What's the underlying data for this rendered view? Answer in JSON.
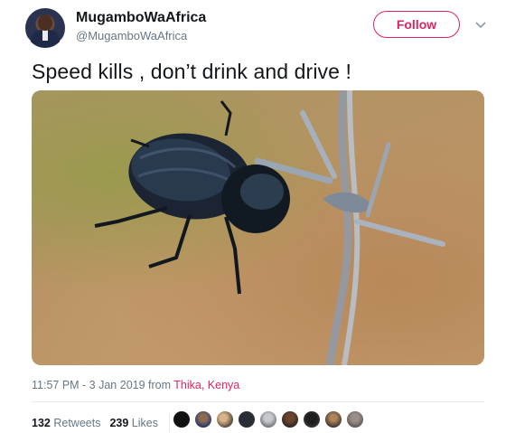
{
  "user": {
    "display_name": "MugamboWaAfrica",
    "handle": "@MugamboWaAfrica"
  },
  "follow_label": "Follow",
  "tweet": {
    "text": "Speed kills , don’t drink and drive !"
  },
  "meta": {
    "time": "11:57 PM - 3 Jan 2019",
    "from_label": "from",
    "place": "Thika, Kenya"
  },
  "stats": {
    "retweets_count": "132",
    "retweets_label": "Retweets",
    "likes_count": "239",
    "likes_label": "Likes"
  },
  "colors": {
    "accent": "#e0245e",
    "secondary_text": "#657786"
  },
  "likers": [
    "liker-1",
    "liker-2",
    "liker-3",
    "liker-4",
    "liker-5",
    "liker-6",
    "liker-7",
    "liker-8",
    "liker-9"
  ]
}
